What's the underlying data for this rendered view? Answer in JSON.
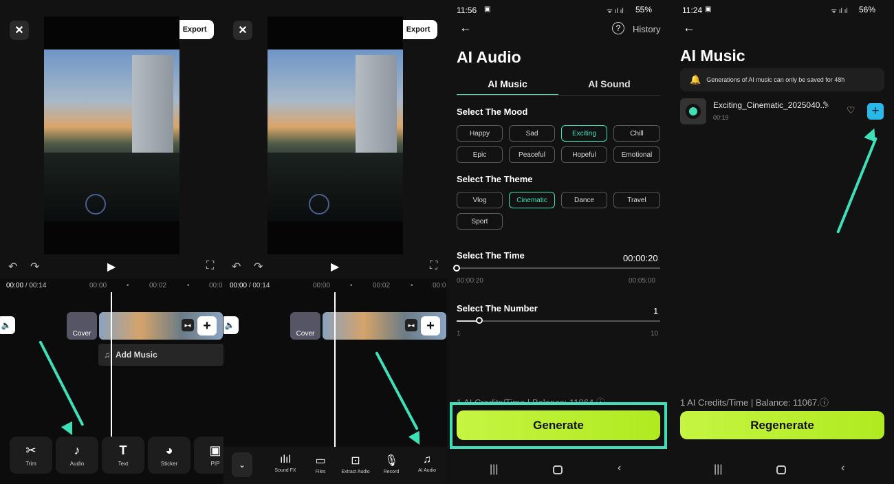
{
  "editor": {
    "export_label": "Export",
    "time_current": "00:00",
    "time_total": "/ 00:14",
    "tick_0": "00:00",
    "tick_2": "00:02",
    "tick_4": "00:0",
    "cover_label": "Cover",
    "add_music_label": "Add Music"
  },
  "toolbar1": {
    "items": [
      {
        "label": "Trim",
        "icon": "scissors-icon"
      },
      {
        "label": "Audio",
        "icon": "music-note-icon"
      },
      {
        "label": "Text",
        "icon": "text-icon"
      },
      {
        "label": "Sticker",
        "icon": "sticker-icon"
      },
      {
        "label": "PIP",
        "icon": "pip-icon"
      }
    ]
  },
  "toolbar2": {
    "items": [
      {
        "label": "Sound FX",
        "icon": "sound-fx-icon"
      },
      {
        "label": "Files",
        "icon": "folder-icon"
      },
      {
        "label": "Extract Audio",
        "icon": "extract-audio-icon"
      },
      {
        "label": "Record",
        "icon": "microphone-icon"
      },
      {
        "label": "AI Audio",
        "icon": "ai-audio-icon"
      }
    ]
  },
  "ai_audio": {
    "status_time": "11:56",
    "battery": "55%",
    "history_label": "History",
    "title": "AI Audio",
    "tab_music": "AI Music",
    "tab_sound": "AI Sound",
    "mood_heading": "Select The Mood",
    "moods": [
      "Happy",
      "Sad",
      "Exciting",
      "Chill",
      "Epic",
      "Peaceful",
      "Hopeful",
      "Emotional"
    ],
    "selected_mood": "Exciting",
    "theme_heading": "Select The Theme",
    "themes": [
      "Vlog",
      "Cinematic",
      "Dance",
      "Travel",
      "Sport"
    ],
    "selected_theme": "Cinematic",
    "time_heading": "Select The Time",
    "time_value": "00:00:20",
    "time_min": "00:00:20",
    "time_max": "00:05:00",
    "time_position": 0.0,
    "number_heading": "Select The Number",
    "number_value": "1",
    "number_min": "1",
    "number_max": "10",
    "number_position": 0.11,
    "credits": "1 AI Credits/Time | Balance: 11064",
    "generate_label": "Generate"
  },
  "ai_music": {
    "status_time": "11:24",
    "battery": "56%",
    "title": "AI Music",
    "notice": "Generations of AI music can only be saved for 48h",
    "track_name": "Exciting_Cinematic_2025040...",
    "track_duration": "00:19",
    "credits": "1 AI Credits/Time | Balance: 11067.",
    "regenerate_label": "Regenerate"
  },
  "colors": {
    "accent": "#3ee0b8",
    "generate": "#c6f542",
    "background": "#121212"
  }
}
